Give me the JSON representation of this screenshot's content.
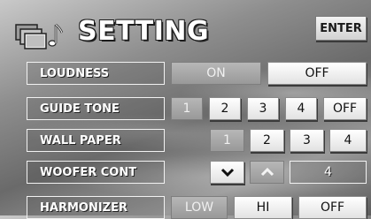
{
  "header": {
    "title": "SETTING",
    "enter_label": "ENTER"
  },
  "rows": {
    "loudness": {
      "label": "LOUDNESS",
      "options": [
        "ON",
        "OFF"
      ],
      "selected": "ON"
    },
    "guide_tone": {
      "label": "GUIDE TONE",
      "options": [
        "1",
        "2",
        "3",
        "4",
        "OFF"
      ],
      "selected": "1"
    },
    "wall_paper": {
      "label": "WALL PAPER",
      "options": [
        "1",
        "2",
        "3",
        "4"
      ],
      "selected": "1"
    },
    "woofer_cont": {
      "label": "WOOFER CONT",
      "value": "4",
      "down_icon": "chevron-down-icon",
      "up_icon": "chevron-up-icon",
      "pressed": "up"
    },
    "harmonizer": {
      "label": "HARMONIZER",
      "options": [
        "LOW",
        "HI",
        "OFF"
      ],
      "selected": "LOW"
    }
  },
  "colors": {
    "selected_button": "#a8a8a8",
    "button": "#f0f0f0",
    "label_text": "#ffffff"
  }
}
